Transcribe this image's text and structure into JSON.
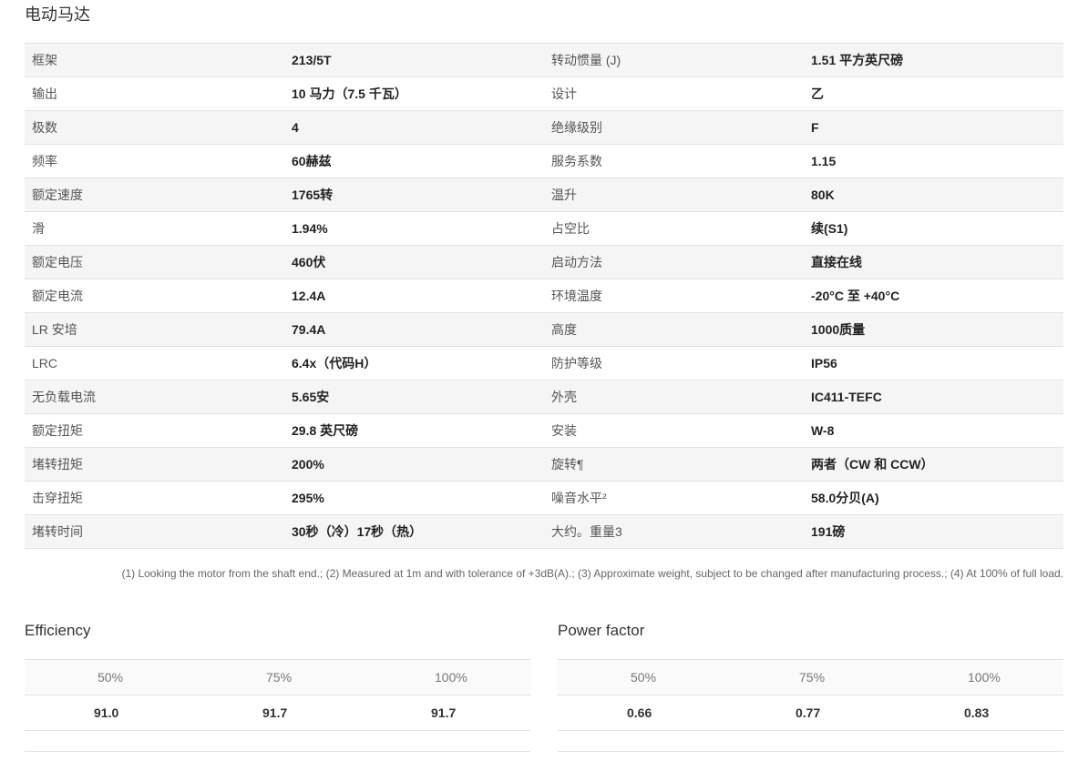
{
  "title": "电动马达",
  "specs": [
    {
      "l1": "框架",
      "v1": "213/5T",
      "l2": "转动惯量 (J)",
      "v2": "1.51 平方英尺磅"
    },
    {
      "l1": "输出",
      "v1": "10 马力（7.5 千瓦）",
      "l2": "设计",
      "v2": "乙"
    },
    {
      "l1": "极数",
      "v1": "4",
      "l2": "绝缘级别",
      "v2": "F"
    },
    {
      "l1": "频率",
      "v1": "60赫兹",
      "l2": "服务系数",
      "v2": "1.15"
    },
    {
      "l1": "额定速度",
      "v1": "1765转",
      "l2": "温升",
      "v2": "80K"
    },
    {
      "l1": "滑",
      "v1": "1.94%",
      "l2": "占空比",
      "v2": "续(S1)"
    },
    {
      "l1": "额定电压",
      "v1": "460伏",
      "l2": "启动方法",
      "v2": "直接在线"
    },
    {
      "l1": "额定电流",
      "v1": "12.4A",
      "l2": "环境温度",
      "v2": "-20°C 至 +40°C"
    },
    {
      "l1": "LR 安培",
      "v1": "79.4A",
      "l2": "高度",
      "v2": "1000质量"
    },
    {
      "l1": "LRC",
      "v1": "6.4x（代码H）",
      "l2": "防护等级",
      "v2": "IP56"
    },
    {
      "l1": "无负载电流",
      "v1": "5.65安",
      "l2": "外壳",
      "v2": "IC411-TEFC"
    },
    {
      "l1": "额定扭矩",
      "v1": "29.8 英尺磅",
      "l2": "安装",
      "v2": "W-8"
    },
    {
      "l1": "堵转扭矩",
      "v1": "200%",
      "l2": "旋转¶",
      "v2": "两者（CW 和 CCW）"
    },
    {
      "l1": "击穿扭矩",
      "v1": "295%",
      "l2": "噪音水平²",
      "v2": "58.0分贝(A)"
    },
    {
      "l1": "堵转时间",
      "v1": "30秒（冷）17秒（热）",
      "l2": "大约。重量3",
      "v2": "191磅"
    }
  ],
  "footnote": "(1) Looking the motor from the shaft end.; (2) Measured at 1m and with tolerance of +3dB(A).; (3) Approximate weight, subject to be changed after manufacturing process.; (4) At 100% of full load.",
  "efficiency": {
    "title": "Efficiency",
    "headers": [
      "50%",
      "75%",
      "100%"
    ],
    "values": [
      "91.0",
      "91.7",
      "91.7"
    ]
  },
  "power_factor": {
    "title": "Power factor",
    "headers": [
      "50%",
      "75%",
      "100%"
    ],
    "values": [
      "0.66",
      "0.77",
      "0.83"
    ]
  }
}
